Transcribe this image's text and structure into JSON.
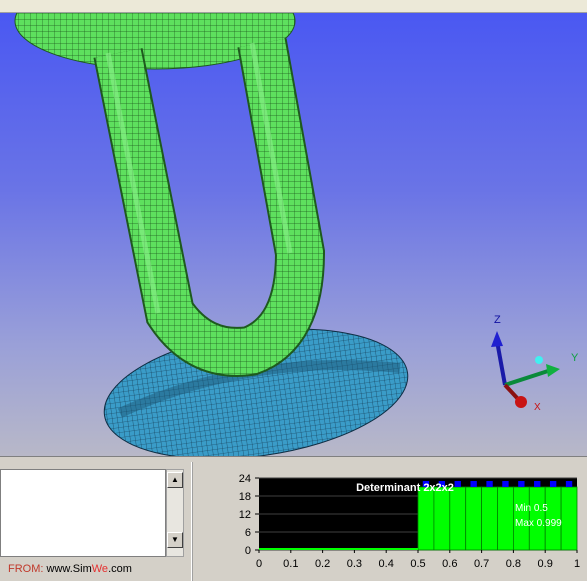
{
  "axis_triad": {
    "z_label": "Z",
    "y_label": "Y",
    "x_label": "X"
  },
  "log_panel": {
    "scroll_up_glyph": "▲",
    "scroll_down_glyph": "▼"
  },
  "watermark": {
    "from": "FROM:",
    "site_prefix": "www.Sim",
    "site_accent": "We",
    "site_suffix": ".com"
  },
  "colors": {
    "viewport_top": "#4a58f2",
    "viewport_bottom": "#b8b8c8",
    "tube_mesh": "#5ee05e",
    "disk_mesh": "#3a9cc8",
    "histogram_fill": "#00ff00",
    "histogram_cap": "#0000ff",
    "histogram_bg": "#000000"
  },
  "chart_data": {
    "type": "bar",
    "title": "Determinant 2x2x2",
    "stats": {
      "min_label": "Min 0.5",
      "max_label": "Max 0.999"
    },
    "x_ticks": [
      "0",
      "0.1",
      "0.2",
      "0.3",
      "0.4",
      "0.5",
      "0.6",
      "0.7",
      "0.8",
      "0.9",
      "1"
    ],
    "y_ticks": [
      "24",
      "18",
      "12",
      "6",
      "0"
    ],
    "xlim": [
      0,
      1
    ],
    "ylim": [
      0,
      24
    ],
    "bins": [
      {
        "x0": 0.5,
        "x1": 0.55,
        "value": 21
      },
      {
        "x0": 0.55,
        "x1": 0.6,
        "value": 21
      },
      {
        "x0": 0.6,
        "x1": 0.65,
        "value": 21
      },
      {
        "x0": 0.65,
        "x1": 0.7,
        "value": 21
      },
      {
        "x0": 0.7,
        "x1": 0.75,
        "value": 21
      },
      {
        "x0": 0.75,
        "x1": 0.8,
        "value": 21
      },
      {
        "x0": 0.8,
        "x1": 0.85,
        "value": 21
      },
      {
        "x0": 0.85,
        "x1": 0.9,
        "value": 21
      },
      {
        "x0": 0.9,
        "x1": 0.95,
        "value": 21
      },
      {
        "x0": 0.95,
        "x1": 1.0,
        "value": 21
      }
    ]
  }
}
